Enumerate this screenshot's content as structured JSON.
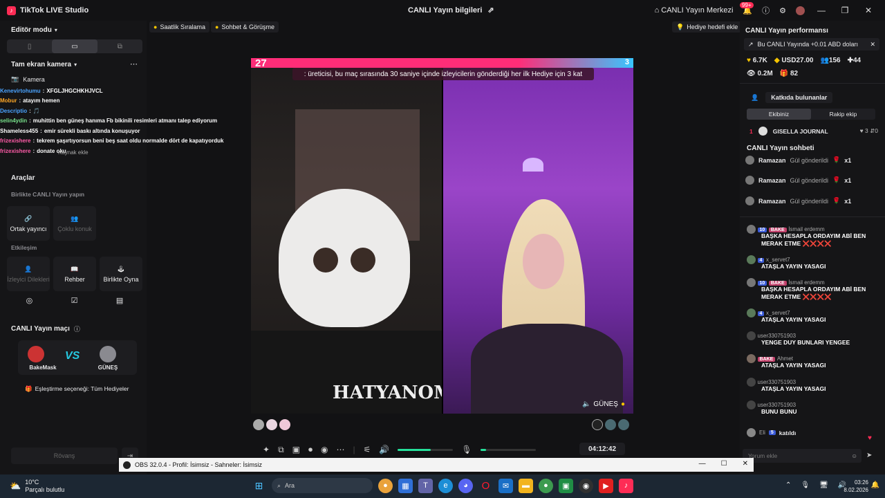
{
  "app": {
    "title": "TikTok LIVE Studio",
    "center_title": "CANLI Yayın bilgileri",
    "live_center": "CANLI Yayın Merkezi",
    "notif_badge": "99+"
  },
  "left": {
    "editor_mode": "Editör modu",
    "camera_section": "Tam ekran kamera",
    "camera_item": "Kamera",
    "tools_title": "Araçlar",
    "together_title": "Birlikte CANLI Yayın yapın",
    "cohost": "Ortak yayıncı",
    "multi_guest": "Çoklu konuk",
    "interaction_title": "Etkileşim",
    "viewer_requests": "İzleyici Dilekleri",
    "guide": "Rehber",
    "play_together": "Birlikte Oyna",
    "match_title": "CANLI Yayın maçı",
    "player_left": "BakeMask",
    "player_right": "GÜNEŞ",
    "vs": "VS",
    "match_option": "Eşleştirme seçeneği: Tüm Hediyeler",
    "rematch": "Rövanş",
    "add_source_hint": "Kaynak ekle"
  },
  "overlay_chat": [
    {
      "user": "Kenevirtohumu",
      "text": "XFGLJHGCHKHJVCL",
      "color": "u-blue"
    },
    {
      "user": "Mobur",
      "text": "atayım hemen",
      "color": "u-orange"
    },
    {
      "user": "Descriptio",
      "text": "🎵",
      "color": "u-blue"
    },
    {
      "user": "selin4ydin",
      "text": "muhittin ben güneş hanıma Fb bikinili resimleri atmanı talep ediyorum",
      "color": "u-green"
    },
    {
      "user": "Shameless455",
      "text": "emir sürekli baskı altında konuşuyor",
      "color": "u-white"
    },
    {
      "user": "frizexishere",
      "text": "tekrem şaşırtıyorsun beni beş saat oldu normalde dört de kapatıyorduk",
      "color": "u-pink"
    },
    {
      "user": "frizexishere",
      "text": "donate oku",
      "color": "u-pink"
    }
  ],
  "center": {
    "chip_hourly": "Saatlik Sıralama",
    "chip_chat": "Sohbet & Görüşme",
    "chip_gift_goal": "Hediye hedefi ekle",
    "score_left": "27",
    "score_right": "3",
    "banner": ": üreticisi, bu maç sırasında 30 saniye içinde izleyicilerin gönderdiği her ilk Hediye için 3 kat",
    "right_cam_name": "GÜNEŞ",
    "timer": "04:12:42",
    "mask_text": "HATYANOM",
    "volume_level": 0.6,
    "mic_level": 0.1
  },
  "right": {
    "perf_title": "CANLI Yayın performansı",
    "promo": "Bu CANLI Yayında +0.01 ABD doları",
    "stats": {
      "likes": "6.7K",
      "usd": "USD27.00",
      "viewers": "156",
      "new": "44",
      "views": "0.2M",
      "gifts": "82"
    },
    "contributors": "Katkıda bulunanlar",
    "tab_ours": "Ekibiniz",
    "tab_opp": "Rakip ekip",
    "top_rank": "1",
    "top_name": "GISELLA JOURNAL",
    "top_likes": "3",
    "top_other": "0",
    "chat_title": "CANLI Yayın sohbeti",
    "gifts": [
      {
        "user": "Ramazan",
        "action": "Gül gönderildi",
        "count": "x1"
      },
      {
        "user": "Ramazan",
        "action": "Gül gönderildi",
        "count": "x1"
      },
      {
        "user": "Ramazan",
        "action": "Gül gönderildi",
        "count": "x1"
      }
    ],
    "messages": [
      {
        "level": "10",
        "tag": "BAKE",
        "user": "İsmail erdemm",
        "text": "BAŞKA HESAPLA ORDAYIM ABİ BEN MERAK ETME ❌❌❌❌"
      },
      {
        "level": "4",
        "tag": "",
        "user": "x_servet7",
        "text": "ATAŞLA YAYIN YASAGI"
      },
      {
        "level": "10",
        "tag": "BAKE",
        "user": "İsmail erdemm",
        "text": "BAŞKA HESAPLA ORDAYIM ABİ BEN MERAK ETME ❌❌❌❌"
      },
      {
        "level": "4",
        "tag": "",
        "user": "x_servet7",
        "text": "ATAŞLA YAYIN YASAGI"
      },
      {
        "level": "",
        "tag": "",
        "user": "user330751903",
        "text": "YENGE DUY BUNLARI YENGEE"
      },
      {
        "level": "",
        "tag": "BAKE",
        "user": "Ahmet",
        "text": "ATAŞLA YAYIN YASAGI"
      },
      {
        "level": "",
        "tag": "",
        "user": "user330751903",
        "text": "ATAŞLA YAYIN YASAGI"
      },
      {
        "level": "",
        "tag": "",
        "user": "user330751903",
        "text": "BUNU BUNU"
      }
    ],
    "joined_user": "Eli",
    "joined_level": "5",
    "joined_text": "katıldı",
    "comment_placeholder": "Yorum ekle"
  },
  "obs": {
    "title": "OBS 32.0.4 - Profil: İsimsiz - Sahneler: İsimsiz"
  },
  "taskbar": {
    "temp": "10°C",
    "weather": "Parçalı bulutlu",
    "search": "Ara",
    "time": "03:26",
    "date": "8.02.2026"
  }
}
